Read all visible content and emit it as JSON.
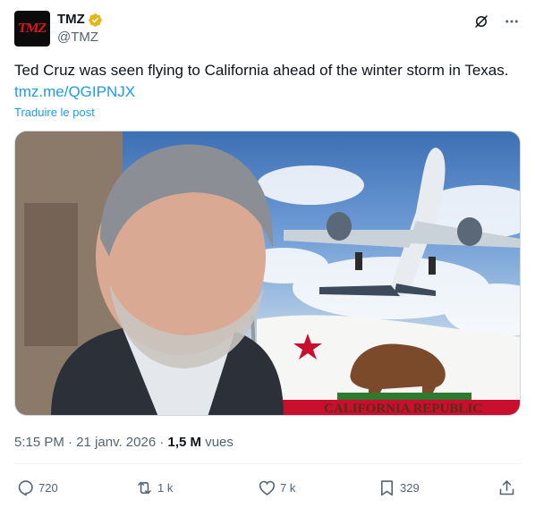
{
  "author": {
    "avatar_text": "TMZ",
    "display_name": "TMZ",
    "handle": "@TMZ",
    "verified": true
  },
  "tweet": {
    "text": "Ted Cruz was seen flying to California ahead of the winter storm in Texas.",
    "link": "tmz.me/QGIPNJX",
    "translate_label": "Traduire le post"
  },
  "media": {
    "flag_text": "CALIFORNIA REPUBLIC"
  },
  "meta": {
    "time": "5:15 PM",
    "date": "21 janv. 2026",
    "views_count": "1,5 M",
    "views_label": "vues"
  },
  "actions": {
    "replies": "720",
    "reposts": "1 k",
    "likes": "7 k",
    "bookmarks": "329"
  },
  "colors": {
    "accent": "#1d9bf0",
    "secondary_text": "#536471",
    "verified_gold": "#e2b719",
    "brand_red": "#e0141e"
  },
  "icons": [
    "verified-badge-icon",
    "grok-icon",
    "more-icon",
    "reply-icon",
    "repost-icon",
    "like-icon",
    "bookmark-icon",
    "share-icon"
  ]
}
